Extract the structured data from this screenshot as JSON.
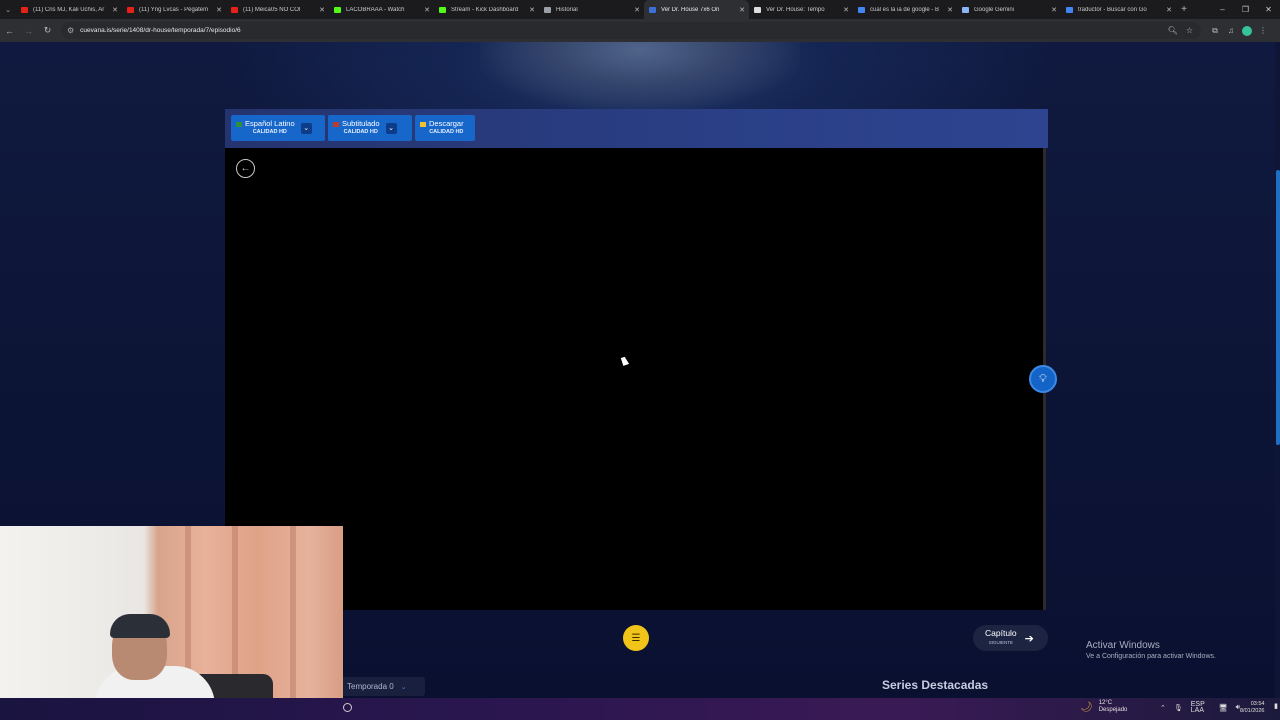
{
  "browser": {
    "tabs": [
      {
        "label": "(11) Cris MJ, Kali Uchis, Ar",
        "favicon_color": "#e62117",
        "active": false
      },
      {
        "label": "(11) Yng Lvcas - Pégatem",
        "favicon_color": "#e62117",
        "active": false
      },
      {
        "label": "(11) Meica05 NO COI",
        "favicon_color": "#e62117",
        "active": false
      },
      {
        "label": "LACOBRAAA - Watch",
        "favicon_color": "#53fc18",
        "active": false
      },
      {
        "label": "Stream - Kick Dashboard",
        "favicon_color": "#53fc18",
        "active": false
      },
      {
        "label": "Historial",
        "favicon_color": "#9aa0a6",
        "active": false
      },
      {
        "label": "Ver Dr. House 7x6 On",
        "favicon_color": "#3d6fd6",
        "active": true
      },
      {
        "label": "Ver Dr. House: Tempo",
        "favicon_color": "#dddddd",
        "active": false
      },
      {
        "label": "cual es la ia de google - B",
        "favicon_color": "#4285f4",
        "active": false
      },
      {
        "label": "Google Gemini",
        "favicon_color": "#8ab4f8",
        "active": false
      },
      {
        "label": "traductor - Buscar con Go",
        "favicon_color": "#4285f4",
        "active": false
      }
    ],
    "new_tab": "+",
    "url": "cuevana.is/serie/1408/dr-house/temporada/7/episodio/6"
  },
  "player": {
    "options": [
      {
        "label": "Español Latino",
        "quality": "CALIDAD HD",
        "flag_color": "#2f8f3a",
        "has_dropdown": true
      },
      {
        "label": "Subtitulado",
        "quality": "CALIDAD HD",
        "flag_color": "#c0392b",
        "has_dropdown": true
      },
      {
        "label": "Descargar",
        "quality": "CALIDAD HD",
        "flag_color": "#f2c12e",
        "has_dropdown": false
      }
    ]
  },
  "controls": {
    "next_label": "Capítulo",
    "next_sub": "SIGUIENTE",
    "season_label": "Temporada 0"
  },
  "sections": {
    "featured_title": "Series Destacadas"
  },
  "windows_notice": {
    "title": "Activar Windows",
    "subtitle": "Ve a Configuración para activar Windows."
  },
  "taskbar": {
    "temperature": "12°C",
    "weather": "Despejado",
    "lang_top": "ESP",
    "lang_bottom": "LAA",
    "time": "03:54",
    "date": "8/01/2026"
  },
  "colors": {
    "accent": "#1766c9",
    "list_button": "#f0c419"
  }
}
